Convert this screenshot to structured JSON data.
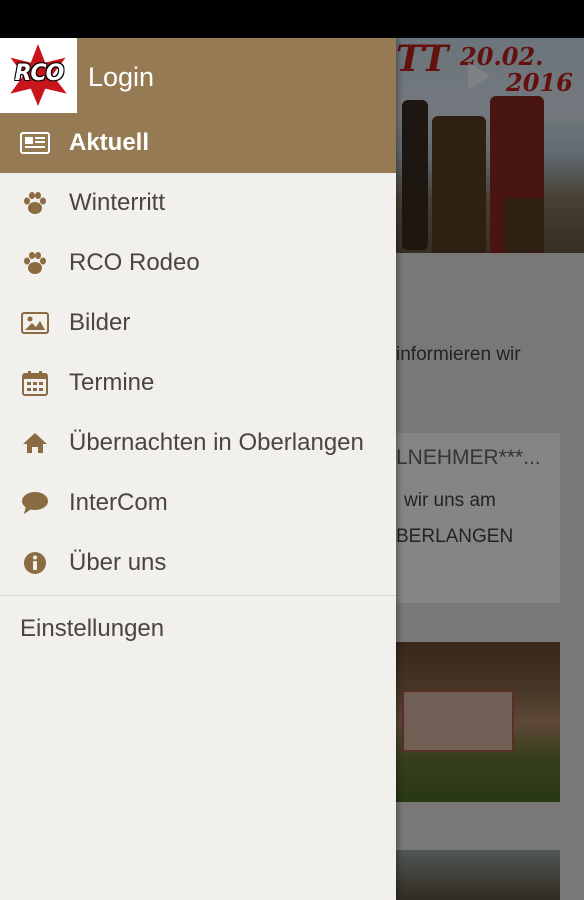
{
  "drawer": {
    "header": {
      "login_label": "Login"
    },
    "items": [
      {
        "label": "Aktuell",
        "icon": "newspaper-icon",
        "active": true
      },
      {
        "label": "Winterritt",
        "icon": "paw-icon"
      },
      {
        "label": "RCO Rodeo",
        "icon": "paw-icon"
      },
      {
        "label": "Bilder",
        "icon": "image-icon"
      },
      {
        "label": "Termine",
        "icon": "calendar-icon"
      },
      {
        "label": "Übernachten in Oberlangen",
        "icon": "home-icon"
      },
      {
        "label": "InterCom",
        "icon": "chat-bubble-icon"
      },
      {
        "label": "Über uns",
        "icon": "info-icon"
      }
    ],
    "settings_label": "Einstellungen",
    "logo_text": "RCO"
  },
  "background": {
    "hero_date_line1": "20.02.",
    "hero_date_line2": "2016",
    "hero_title_fragment": "TT",
    "text_line1": "informieren wir",
    "card_title": "LNEHMER***...",
    "card_line1": "wir uns am",
    "card_line2": "BERLANGEN"
  },
  "colors": {
    "accent": "#957a54",
    "drawer_bg": "#f2f0ed",
    "icon": "#8a6b42",
    "text": "#4a4542"
  }
}
